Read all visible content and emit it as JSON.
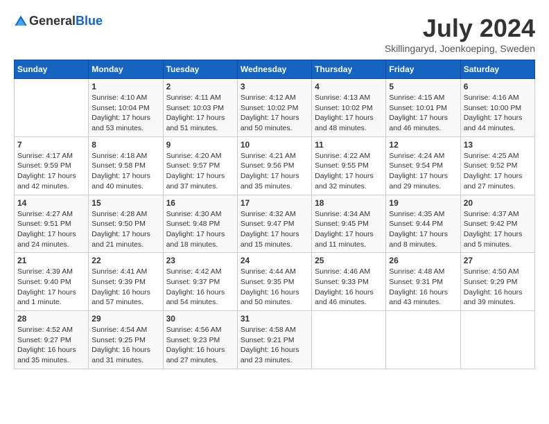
{
  "header": {
    "logo_general": "General",
    "logo_blue": "Blue",
    "month_title": "July 2024",
    "subtitle": "Skillingaryd, Joenkoeping, Sweden"
  },
  "days_of_week": [
    "Sunday",
    "Monday",
    "Tuesday",
    "Wednesday",
    "Thursday",
    "Friday",
    "Saturday"
  ],
  "weeks": [
    [
      {
        "day": "",
        "info": ""
      },
      {
        "day": "1",
        "info": "Sunrise: 4:10 AM\nSunset: 10:04 PM\nDaylight: 17 hours\nand 53 minutes."
      },
      {
        "day": "2",
        "info": "Sunrise: 4:11 AM\nSunset: 10:03 PM\nDaylight: 17 hours\nand 51 minutes."
      },
      {
        "day": "3",
        "info": "Sunrise: 4:12 AM\nSunset: 10:02 PM\nDaylight: 17 hours\nand 50 minutes."
      },
      {
        "day": "4",
        "info": "Sunrise: 4:13 AM\nSunset: 10:02 PM\nDaylight: 17 hours\nand 48 minutes."
      },
      {
        "day": "5",
        "info": "Sunrise: 4:15 AM\nSunset: 10:01 PM\nDaylight: 17 hours\nand 46 minutes."
      },
      {
        "day": "6",
        "info": "Sunrise: 4:16 AM\nSunset: 10:00 PM\nDaylight: 17 hours\nand 44 minutes."
      }
    ],
    [
      {
        "day": "7",
        "info": "Sunrise: 4:17 AM\nSunset: 9:59 PM\nDaylight: 17 hours\nand 42 minutes."
      },
      {
        "day": "8",
        "info": "Sunrise: 4:18 AM\nSunset: 9:58 PM\nDaylight: 17 hours\nand 40 minutes."
      },
      {
        "day": "9",
        "info": "Sunrise: 4:20 AM\nSunset: 9:57 PM\nDaylight: 17 hours\nand 37 minutes."
      },
      {
        "day": "10",
        "info": "Sunrise: 4:21 AM\nSunset: 9:56 PM\nDaylight: 17 hours\nand 35 minutes."
      },
      {
        "day": "11",
        "info": "Sunrise: 4:22 AM\nSunset: 9:55 PM\nDaylight: 17 hours\nand 32 minutes."
      },
      {
        "day": "12",
        "info": "Sunrise: 4:24 AM\nSunset: 9:54 PM\nDaylight: 17 hours\nand 29 minutes."
      },
      {
        "day": "13",
        "info": "Sunrise: 4:25 AM\nSunset: 9:52 PM\nDaylight: 17 hours\nand 27 minutes."
      }
    ],
    [
      {
        "day": "14",
        "info": "Sunrise: 4:27 AM\nSunset: 9:51 PM\nDaylight: 17 hours\nand 24 minutes."
      },
      {
        "day": "15",
        "info": "Sunrise: 4:28 AM\nSunset: 9:50 PM\nDaylight: 17 hours\nand 21 minutes."
      },
      {
        "day": "16",
        "info": "Sunrise: 4:30 AM\nSunset: 9:48 PM\nDaylight: 17 hours\nand 18 minutes."
      },
      {
        "day": "17",
        "info": "Sunrise: 4:32 AM\nSunset: 9:47 PM\nDaylight: 17 hours\nand 15 minutes."
      },
      {
        "day": "18",
        "info": "Sunrise: 4:34 AM\nSunset: 9:45 PM\nDaylight: 17 hours\nand 11 minutes."
      },
      {
        "day": "19",
        "info": "Sunrise: 4:35 AM\nSunset: 9:44 PM\nDaylight: 17 hours\nand 8 minutes."
      },
      {
        "day": "20",
        "info": "Sunrise: 4:37 AM\nSunset: 9:42 PM\nDaylight: 17 hours\nand 5 minutes."
      }
    ],
    [
      {
        "day": "21",
        "info": "Sunrise: 4:39 AM\nSunset: 9:40 PM\nDaylight: 17 hours\nand 1 minute."
      },
      {
        "day": "22",
        "info": "Sunrise: 4:41 AM\nSunset: 9:39 PM\nDaylight: 16 hours\nand 57 minutes."
      },
      {
        "day": "23",
        "info": "Sunrise: 4:42 AM\nSunset: 9:37 PM\nDaylight: 16 hours\nand 54 minutes."
      },
      {
        "day": "24",
        "info": "Sunrise: 4:44 AM\nSunset: 9:35 PM\nDaylight: 16 hours\nand 50 minutes."
      },
      {
        "day": "25",
        "info": "Sunrise: 4:46 AM\nSunset: 9:33 PM\nDaylight: 16 hours\nand 46 minutes."
      },
      {
        "day": "26",
        "info": "Sunrise: 4:48 AM\nSunset: 9:31 PM\nDaylight: 16 hours\nand 43 minutes."
      },
      {
        "day": "27",
        "info": "Sunrise: 4:50 AM\nSunset: 9:29 PM\nDaylight: 16 hours\nand 39 minutes."
      }
    ],
    [
      {
        "day": "28",
        "info": "Sunrise: 4:52 AM\nSunset: 9:27 PM\nDaylight: 16 hours\nand 35 minutes."
      },
      {
        "day": "29",
        "info": "Sunrise: 4:54 AM\nSunset: 9:25 PM\nDaylight: 16 hours\nand 31 minutes."
      },
      {
        "day": "30",
        "info": "Sunrise: 4:56 AM\nSunset: 9:23 PM\nDaylight: 16 hours\nand 27 minutes."
      },
      {
        "day": "31",
        "info": "Sunrise: 4:58 AM\nSunset: 9:21 PM\nDaylight: 16 hours\nand 23 minutes."
      },
      {
        "day": "",
        "info": ""
      },
      {
        "day": "",
        "info": ""
      },
      {
        "day": "",
        "info": ""
      }
    ]
  ]
}
